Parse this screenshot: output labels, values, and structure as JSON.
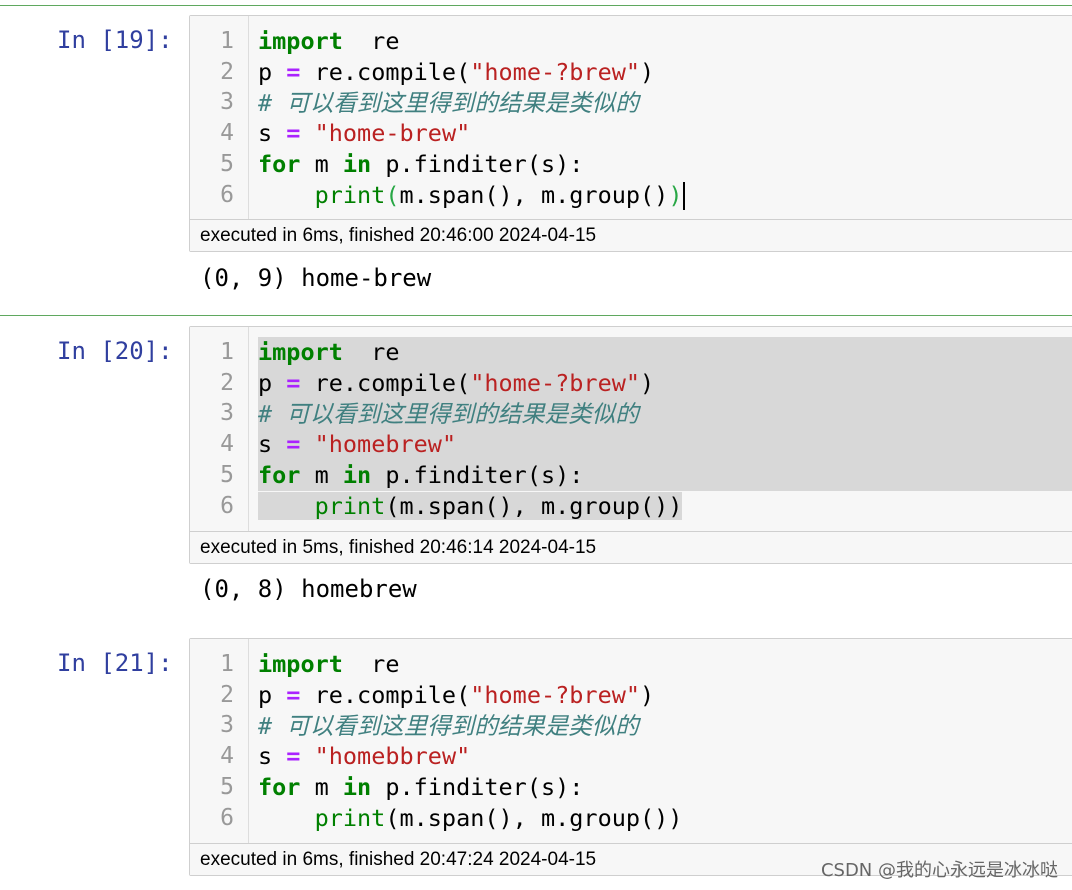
{
  "cells": [
    {
      "prompt": "In [19]:",
      "lines": [
        {
          "no": "1",
          "parts": [
            [
              "kw",
              "import"
            ],
            [
              "",
              "  re"
            ]
          ]
        },
        {
          "no": "2",
          "parts": [
            [
              "",
              "p "
            ],
            [
              "op",
              "="
            ],
            [
              "",
              " re.compile("
            ],
            [
              "str",
              "\"home-?brew\""
            ],
            [
              "",
              ")"
            ]
          ]
        },
        {
          "no": "3",
          "parts": [
            [
              "cm",
              "# 可以看到这里得到的结果是类似的"
            ]
          ]
        },
        {
          "no": "4",
          "parts": [
            [
              "",
              "s "
            ],
            [
              "op",
              "="
            ],
            [
              "",
              " "
            ],
            [
              "str",
              "\"home-brew\""
            ]
          ]
        },
        {
          "no": "5",
          "parts": [
            [
              "kw",
              "for"
            ],
            [
              "",
              " m "
            ],
            [
              "kw",
              "in"
            ],
            [
              "",
              " p.finditer(s):"
            ]
          ]
        },
        {
          "no": "6",
          "parts": [
            [
              "",
              "    "
            ],
            [
              "bi",
              "print"
            ],
            [
              "mp",
              "("
            ],
            [
              "",
              "m.span(), m.group()"
            ],
            [
              "mp",
              ")"
            ],
            [
              "cur",
              ""
            ]
          ]
        }
      ],
      "footer": "executed in 6ms, finished 20:46:00 2024-04-15",
      "output": "(0, 9) home-brew"
    },
    {
      "prompt": "In [20]:",
      "lines": [
        {
          "no": "1",
          "parts": [
            [
              "kw",
              "import"
            ],
            [
              "",
              "  re"
            ]
          ]
        },
        {
          "no": "2",
          "parts": [
            [
              "",
              "p "
            ],
            [
              "op",
              "="
            ],
            [
              "",
              " re.compile("
            ],
            [
              "str",
              "\"home-?brew\""
            ],
            [
              "",
              ")"
            ]
          ]
        },
        {
          "no": "3",
          "parts": [
            [
              "cm",
              "# 可以看到这里得到的结果是类似的"
            ]
          ]
        },
        {
          "no": "4",
          "parts": [
            [
              "",
              "s "
            ],
            [
              "op",
              "="
            ],
            [
              "",
              " "
            ],
            [
              "str",
              "\"homebrew\""
            ]
          ]
        },
        {
          "no": "5",
          "parts": [
            [
              "kw",
              "for"
            ],
            [
              "",
              " m "
            ],
            [
              "kw",
              "in"
            ],
            [
              "",
              " p.finditer(s):"
            ]
          ]
        },
        {
          "no": "6",
          "parts": [
            [
              "",
              "    "
            ],
            [
              "bi",
              "print"
            ],
            [
              "",
              "(m.span(), m.group())"
            ]
          ]
        }
      ],
      "highlighted": true,
      "footer": "executed in 5ms, finished 20:46:14 2024-04-15",
      "output": "(0, 8) homebrew"
    },
    {
      "prompt": "In [21]:",
      "lines": [
        {
          "no": "1",
          "parts": [
            [
              "kw",
              "import"
            ],
            [
              "",
              "  re"
            ]
          ]
        },
        {
          "no": "2",
          "parts": [
            [
              "",
              "p "
            ],
            [
              "op",
              "="
            ],
            [
              "",
              " re.compile("
            ],
            [
              "str",
              "\"home-?brew\""
            ],
            [
              "",
              ")"
            ]
          ]
        },
        {
          "no": "3",
          "parts": [
            [
              "cm",
              "# 可以看到这里得到的结果是类似的"
            ]
          ]
        },
        {
          "no": "4",
          "parts": [
            [
              "",
              "s "
            ],
            [
              "op",
              "="
            ],
            [
              "",
              " "
            ],
            [
              "str",
              "\"homebbrew\""
            ]
          ]
        },
        {
          "no": "5",
          "parts": [
            [
              "kw",
              "for"
            ],
            [
              "",
              " m "
            ],
            [
              "kw",
              "in"
            ],
            [
              "",
              " p.finditer(s):"
            ]
          ]
        },
        {
          "no": "6",
          "parts": [
            [
              "",
              "    "
            ],
            [
              "bi",
              "print"
            ],
            [
              "",
              "(m.span(), m.group())"
            ]
          ]
        }
      ],
      "footer": "executed in 6ms, finished 20:47:24 2024-04-15",
      "output": ""
    }
  ],
  "watermark": "CSDN @我的心永远是冰冰哒"
}
